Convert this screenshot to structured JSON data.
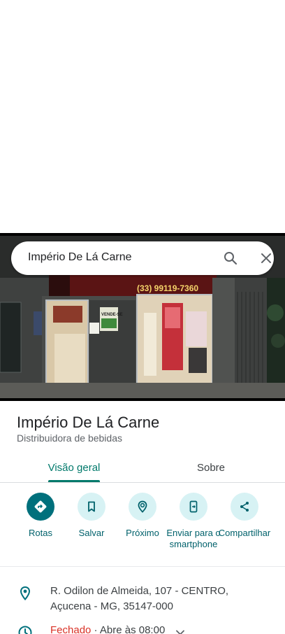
{
  "search": {
    "query": "Império De Lá Carne"
  },
  "storefront_sign": {
    "phone": "(33) 99119-7360",
    "poster_text": "VENDE-SE"
  },
  "place": {
    "name": "Império De Lá Carne",
    "category": "Distribuidora de bebidas"
  },
  "tabs": [
    {
      "label": "Visão geral",
      "selected": true
    },
    {
      "label": "Sobre",
      "selected": false
    }
  ],
  "actions": [
    {
      "label": "Rotas",
      "icon": "directions-icon"
    },
    {
      "label": "Salvar",
      "icon": "bookmark-icon"
    },
    {
      "label": "Próximo",
      "icon": "nearby-icon"
    },
    {
      "label": "Enviar para o smartphone",
      "icon": "send-to-phone-icon"
    },
    {
      "label": "Compartilhar",
      "icon": "share-icon"
    }
  ],
  "address": {
    "text": "R. Odilon de Almeida, 107 - CENTRO, Açucena - MG, 35147-000"
  },
  "hours": {
    "status": "Fechado",
    "separator": " · ",
    "next": "Abre às 08:00"
  },
  "colors": {
    "accent": "#00707c",
    "accent_light": "#d7f2f4",
    "closed_red": "#d93025"
  }
}
